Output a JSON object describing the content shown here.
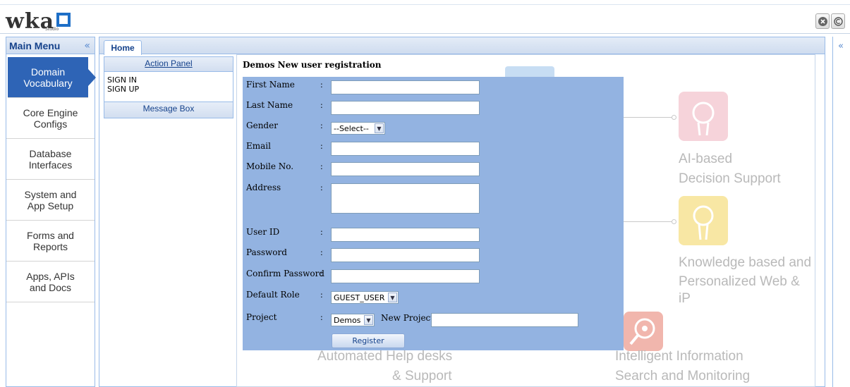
{
  "header": {
    "logo_text": "wka",
    "logo_sub": "Studio",
    "accent_color": "#1e6fc7"
  },
  "left_menu": {
    "title": "Main Menu",
    "collapse_icon": "double-chevron-left",
    "items": [
      {
        "label_line1": "Domain",
        "label_line2": "Vocabulary",
        "active": true
      },
      {
        "label_line1": "Core Engine",
        "label_line2": "Configs"
      },
      {
        "label_line1": "Database",
        "label_line2": "Interfaces"
      },
      {
        "label_line1": "System and",
        "label_line2": "App Setup"
      },
      {
        "label_line1": "Forms and",
        "label_line2": "Reports"
      },
      {
        "label_line1": "Apps, APIs",
        "label_line2": "and Docs"
      }
    ]
  },
  "tabs": [
    {
      "label": "Home"
    }
  ],
  "action_panel": {
    "title": "Action Panel",
    "links": [
      "SIGN IN",
      "SIGN UP"
    ],
    "message_box_title": "Message Box"
  },
  "form": {
    "title": "Demos New user registration",
    "fields": {
      "first_name": "First Name",
      "last_name": "Last Name",
      "gender": "Gender",
      "email": "Email",
      "mobile": "Mobile No.",
      "address": "Address",
      "user_id": "User ID",
      "password": "Password",
      "confirm_password": "Confirm Password",
      "default_role": "Default Role",
      "project": "Project"
    },
    "colon": ":",
    "gender_value": "--Select--",
    "role_value": "GUEST_USER",
    "project_value": "Demos",
    "new_project_label": "New Project?",
    "register_label": "Register"
  },
  "background": {
    "decision_line1": "AI-based",
    "decision_line2": "Decision Support",
    "knowledge_line1": "Knowledge based and",
    "knowledge_line2": "Personalized Web & iP",
    "help_line1": "Automated Help desks",
    "help_line2": "& Support",
    "info_line1": "Intelligent Information",
    "info_line2": "Search and Monitoring"
  }
}
